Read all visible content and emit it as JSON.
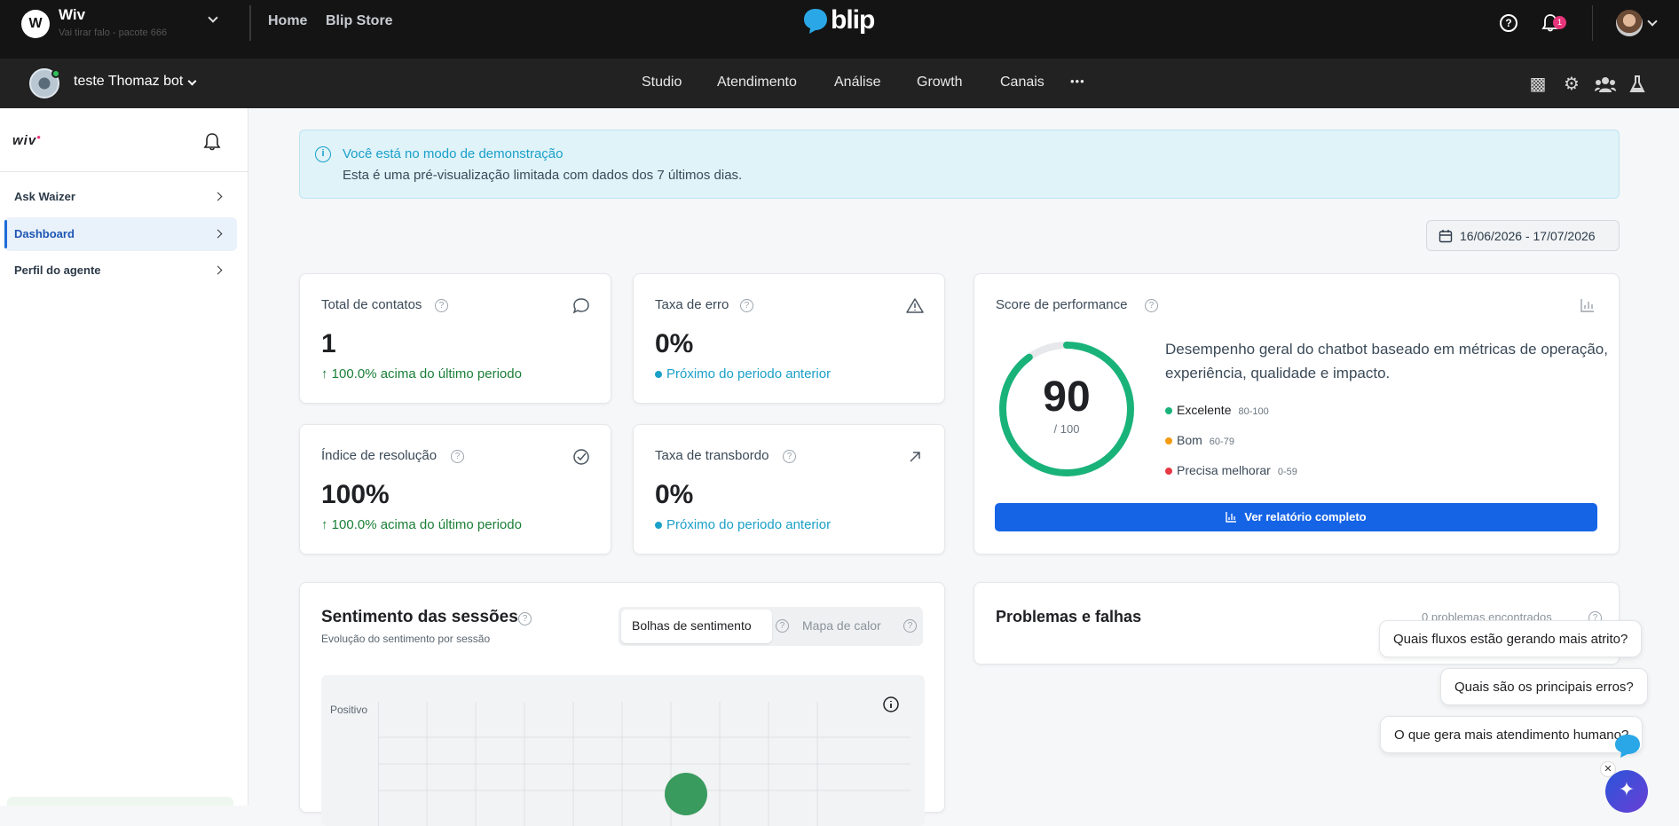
{
  "topbar": {
    "org_initial": "W",
    "org_name": "Wiv",
    "org_sub": "Vai tirar falo - pacote 666",
    "links": [
      "Home",
      "Blip Store"
    ],
    "brand": "blip",
    "notification_count": "1"
  },
  "subbar": {
    "bot_name": "teste Thomaz bot",
    "nav": [
      "Studio",
      "Atendimento",
      "Análise",
      "Growth",
      "Canais"
    ],
    "more": "•••",
    "tools": [
      "puzzle-icon",
      "gear-icon",
      "team-icon",
      "flask-icon"
    ]
  },
  "sidebar": {
    "logo": "wiv",
    "items": [
      {
        "label": "Ask Waizer",
        "active": false
      },
      {
        "label": "Dashboard",
        "active": true
      },
      {
        "label": "Perfil do agente",
        "active": false
      }
    ]
  },
  "banner": {
    "title": "Você está no modo de demonstração",
    "text": "Esta é uma pré-visualização limitada com dados dos 7 últimos dias."
  },
  "date_range": "16/06/2026 - 17/07/2026",
  "metrics": [
    {
      "title": "Total de contatos",
      "value": "1",
      "trend": "100.0% acima do último periodo",
      "trend_type": "up",
      "icon": "chat-icon"
    },
    {
      "title": "Taxa de erro",
      "value": "0%",
      "trend": "Próximo do periodo anterior",
      "trend_type": "neutral",
      "icon": "warning-icon"
    },
    {
      "title": "Índice de resolução",
      "value": "100%",
      "trend": "100.0% acima do último periodo",
      "trend_type": "up",
      "icon": "check-circle-icon"
    },
    {
      "title": "Taxa de transbordo",
      "value": "0%",
      "trend": "Próximo do periodo anterior",
      "trend_type": "neutral",
      "icon": "arrow-up-right-icon"
    }
  ],
  "performance": {
    "title": "Score de performance",
    "score": "90",
    "max": "/ 100",
    "score_fraction": 0.9,
    "description": "Desempenho geral do chatbot baseado em métricas de operação, experiência, qualidade e impacto.",
    "legend": [
      {
        "label": "Excelente",
        "range": "80-100",
        "color": "#19b37a"
      },
      {
        "label": "Bom",
        "range": "60-79",
        "color": "#f39c12"
      },
      {
        "label": "Precisa melhorar",
        "range": "0-59",
        "color": "#e63946"
      }
    ],
    "button": "Ver relatório completo"
  },
  "sentiment": {
    "title": "Sentimento das sessões",
    "subtitle": "Evolução do sentimento por sessão",
    "tabs": [
      "Bolhas de sentimento",
      "Mapa de calor"
    ],
    "y_label": "Positivo"
  },
  "problems": {
    "title": "Problemas e falhas",
    "count": "0 problemas encontrados"
  },
  "suggestions": [
    "Quais fluxos estão gerando mais atrito?",
    "Quais são os principais erros?",
    "O que gera mais atendimento humano?"
  ],
  "colors": {
    "accent": "#1664e6",
    "success": "#1a7f37",
    "info": "#1ba0c8",
    "score_ring": "#19b37a"
  }
}
